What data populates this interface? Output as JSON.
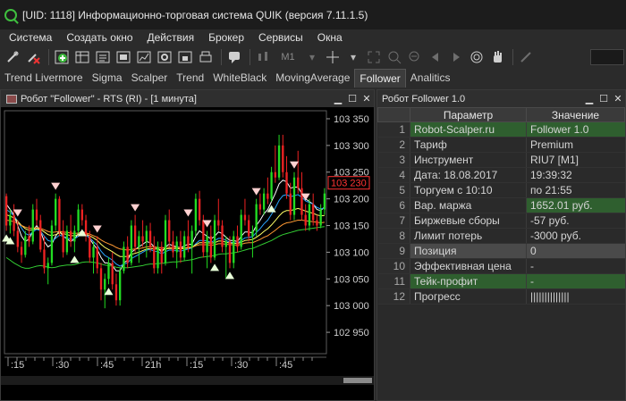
{
  "window": {
    "title": "[UID: 1118] Информационно-торговая система QUIK (версия 7.11.1.5)"
  },
  "menu": {
    "items": [
      "Система",
      "Создать окно",
      "Действия",
      "Брокер",
      "Сервисы",
      "Окна"
    ]
  },
  "toolbar": {
    "timeframe": "M1"
  },
  "tabs": {
    "items": [
      "Trend Livermore",
      "Sigma",
      "Scalper",
      "Trend",
      "WhiteBlack",
      "MovingAverage",
      "Follower",
      "Analitics"
    ],
    "active_index": 6
  },
  "chart_window": {
    "title": "Робот \"Follower\" - RTS (RI) - [1 минута]",
    "current_price": "103 230"
  },
  "colors": {
    "bull": "#22dd22",
    "bear": "#ee2222",
    "current_price": "#ff3333",
    "highlight_row": "#2f5f2f"
  },
  "chart_data": {
    "type": "candlestick",
    "y_ticks": [
      103350,
      103300,
      103250,
      103200,
      103150,
      103100,
      103050,
      103000,
      102950
    ],
    "y_tick_labels": [
      "103 350",
      "103 300",
      "103 250",
      "103 200",
      "103 150",
      "103 100",
      "103 050",
      "103 000",
      "102 950"
    ],
    "ylim": [
      102910,
      103365
    ],
    "x_tick_labels": [
      ":15",
      ":30",
      ":45",
      "21h",
      ":15",
      ":30",
      ":45"
    ],
    "current_price": 103230,
    "candles": [
      [
        103205,
        103210,
        103140,
        103150
      ],
      [
        103150,
        103180,
        103135,
        103170
      ],
      [
        103170,
        103190,
        103130,
        103140
      ],
      [
        103140,
        103160,
        103100,
        103110
      ],
      [
        103110,
        103120,
        103080,
        103095
      ],
      [
        103095,
        103140,
        103090,
        103130
      ],
      [
        103130,
        103150,
        103110,
        103120
      ],
      [
        103120,
        103190,
        103115,
        103180
      ],
      [
        103180,
        103200,
        103150,
        103160
      ],
      [
        103160,
        103170,
        103100,
        103105
      ],
      [
        103105,
        103130,
        103060,
        103070
      ],
      [
        103070,
        103090,
        103040,
        103080
      ],
      [
        103080,
        103160,
        103075,
        103150
      ],
      [
        103150,
        103210,
        103140,
        103200
      ],
      [
        103200,
        103205,
        103130,
        103140
      ],
      [
        103140,
        103160,
        103090,
        103100
      ],
      [
        103100,
        103150,
        103095,
        103140
      ],
      [
        103140,
        103170,
        103110,
        103120
      ],
      [
        103120,
        103150,
        103100,
        103140
      ],
      [
        103140,
        103190,
        103135,
        103180
      ],
      [
        103180,
        103190,
        103150,
        103160
      ],
      [
        103160,
        103170,
        103120,
        103130
      ],
      [
        103130,
        103140,
        103080,
        103090
      ],
      [
        103090,
        103120,
        103060,
        103110
      ],
      [
        103110,
        103130,
        103060,
        103070
      ],
      [
        103070,
        103080,
        103010,
        103030
      ],
      [
        103030,
        103060,
        102995,
        103050
      ],
      [
        103050,
        103090,
        103040,
        103080
      ],
      [
        103080,
        103100,
        103030,
        103040
      ],
      [
        103040,
        103060,
        103000,
        103010
      ],
      [
        103010,
        103070,
        103000,
        103065
      ],
      [
        103065,
        103120,
        103060,
        103110
      ],
      [
        103110,
        103130,
        103070,
        103080
      ],
      [
        103080,
        103160,
        103075,
        103150
      ],
      [
        103150,
        103170,
        103100,
        103110
      ],
      [
        103110,
        103140,
        103080,
        103130
      ],
      [
        103130,
        103160,
        103110,
        103120
      ],
      [
        103120,
        103150,
        103090,
        103140
      ],
      [
        103140,
        103155,
        103100,
        103110
      ],
      [
        103110,
        103130,
        103060,
        103070
      ],
      [
        103070,
        103120,
        103060,
        103110
      ],
      [
        103110,
        103120,
        103060,
        103080
      ],
      [
        103080,
        103170,
        103075,
        103160
      ],
      [
        103160,
        103180,
        103110,
        103120
      ],
      [
        103120,
        103140,
        103090,
        103100
      ],
      [
        103100,
        103130,
        103070,
        103120
      ],
      [
        103120,
        103140,
        103080,
        103090
      ],
      [
        103090,
        103140,
        103085,
        103130
      ],
      [
        103130,
        103160,
        103100,
        103110
      ],
      [
        103110,
        103150,
        103060,
        103140
      ],
      [
        103140,
        103210,
        103130,
        103200
      ],
      [
        103200,
        103215,
        103150,
        103160
      ],
      [
        103160,
        103170,
        103090,
        103100
      ],
      [
        103100,
        103140,
        103070,
        103130
      ],
      [
        103130,
        103150,
        103080,
        103090
      ],
      [
        103090,
        103170,
        103085,
        103160
      ],
      [
        103160,
        103200,
        103140,
        103150
      ],
      [
        103150,
        103160,
        103100,
        103110
      ],
      [
        103110,
        103130,
        103050,
        103120
      ],
      [
        103120,
        103130,
        103070,
        103080
      ],
      [
        103080,
        103140,
        103070,
        103130
      ],
      [
        103130,
        103150,
        103100,
        103110
      ],
      [
        103110,
        103180,
        103105,
        103170
      ],
      [
        103170,
        103200,
        103150,
        103160
      ],
      [
        103160,
        103170,
        103120,
        103130
      ],
      [
        103130,
        103150,
        103090,
        103140
      ],
      [
        103140,
        103200,
        103130,
        103190
      ],
      [
        103190,
        103210,
        103170,
        103180
      ],
      [
        103180,
        103220,
        103170,
        103210
      ],
      [
        103210,
        103240,
        103190,
        103200
      ],
      [
        103200,
        103260,
        103195,
        103250
      ],
      [
        103250,
        103300,
        103230,
        103240
      ],
      [
        103240,
        103320,
        103235,
        103300
      ],
      [
        103300,
        103320,
        103240,
        103250
      ],
      [
        103250,
        103280,
        103200,
        103210
      ],
      [
        103210,
        103230,
        103160,
        103170
      ],
      [
        103170,
        103250,
        103160,
        103240
      ],
      [
        103240,
        103290,
        103210,
        103220
      ],
      [
        103220,
        103250,
        103160,
        103170
      ],
      [
        103170,
        103190,
        103140,
        103150
      ],
      [
        103150,
        103200,
        103140,
        103190
      ],
      [
        103190,
        103210,
        103150,
        103160
      ],
      [
        103160,
        103170,
        103140,
        103150
      ],
      [
        103150,
        103190,
        103145,
        103180
      ],
      [
        103180,
        103220,
        103170,
        103210
      ]
    ],
    "ma_series": [
      {
        "color": "#ffffff",
        "values": [
          103190,
          103180,
          103170,
          103150,
          103130,
          103120,
          103125,
          103140,
          103150,
          103140,
          103120,
          103110,
          103115,
          103130,
          103140,
          103130,
          103125,
          103120,
          103125,
          103135,
          103140,
          103135,
          103125,
          103115,
          103105,
          103090,
          103080,
          103080,
          103075,
          103065,
          103065,
          103080,
          103085,
          103100,
          103105,
          103110,
          103115,
          103120,
          103118,
          103110,
          103108,
          103100,
          103110,
          103115,
          103112,
          103110,
          103108,
          103112,
          103115,
          103115,
          103130,
          103140,
          103135,
          103130,
          103125,
          103130,
          103138,
          103135,
          103128,
          103122,
          103122,
          103120,
          103130,
          103138,
          103138,
          103136,
          103150,
          103160,
          103172,
          103180,
          103195,
          103210,
          103228,
          103235,
          103232,
          103220,
          103222,
          103222,
          103210,
          103200,
          103195,
          103190,
          103180,
          103178,
          103185
        ]
      },
      {
        "color": "#2aa6ff",
        "values": [
          103180,
          103175,
          103168,
          103158,
          103145,
          103135,
          103132,
          103138,
          103143,
          103140,
          103130,
          103122,
          103120,
          103126,
          103132,
          103130,
          103127,
          103124,
          103125,
          103130,
          103133,
          103132,
          103127,
          103120,
          103113,
          103102,
          103094,
          103090,
          103085,
          103078,
          103074,
          103078,
          103080,
          103088,
          103092,
          103096,
          103100,
          103104,
          103105,
          103102,
          103101,
          103097,
          103101,
          103104,
          103104,
          103103,
          103102,
          103104,
          103106,
          103108,
          103116,
          103122,
          103122,
          103121,
          103119,
          103122,
          103126,
          103126,
          103122,
          103119,
          103118,
          103117,
          103122,
          103127,
          103128,
          103129,
          103137,
          103144,
          103153,
          103160,
          103171,
          103183,
          103197,
          103206,
          103208,
          103204,
          103206,
          103208,
          103203,
          103196,
          103193,
          103190,
          103184,
          103181,
          103183
        ]
      },
      {
        "color": "#ffff66",
        "values": [
          103170,
          103168,
          103164,
          103158,
          103150,
          103144,
          103141,
          103142,
          103144,
          103143,
          103138,
          103133,
          103131,
          103133,
          103136,
          103135,
          103133,
          103131,
          103131,
          103133,
          103135,
          103134,
          103131,
          103127,
          103122,
          103115,
          103109,
          103105,
          103101,
          103096,
          103092,
          103092,
          103092,
          103096,
          103098,
          103100,
          103103,
          103106,
          103107,
          103106,
          103106,
          103104,
          103106,
          103107,
          103107,
          103107,
          103106,
          103107,
          103108,
          103109,
          103114,
          103118,
          103118,
          103118,
          103117,
          103118,
          103121,
          103121,
          103119,
          103117,
          103117,
          103116,
          103119,
          103122,
          103123,
          103124,
          103128,
          103133,
          103139,
          103144,
          103151,
          103159,
          103168,
          103175,
          103178,
          103178,
          103180,
          103182,
          103180,
          103177,
          103175,
          103173,
          103170,
          103168,
          103169
        ]
      },
      {
        "color": "#ff9933",
        "values": [
          103160,
          103159,
          103157,
          103154,
          103150,
          103147,
          103145,
          103145,
          103146,
          103145,
          103142,
          103139,
          103137,
          103138,
          103139,
          103138,
          103137,
          103136,
          103135,
          103136,
          103137,
          103136,
          103134,
          103131,
          103128,
          103123,
          103119,
          103116,
          103113,
          103109,
          103106,
          103105,
          103104,
          103105,
          103106,
          103107,
          103108,
          103110,
          103110,
          103110,
          103109,
          103108,
          103109,
          103109,
          103109,
          103109,
          103108,
          103108,
          103109,
          103109,
          103112,
          103114,
          103114,
          103114,
          103113,
          103114,
          103116,
          103116,
          103115,
          103114,
          103114,
          103113,
          103115,
          103117,
          103118,
          103118,
          103121,
          103124,
          103128,
          103131,
          103136,
          103141,
          103147,
          103152,
          103155,
          103156,
          103158,
          103160,
          103160,
          103159,
          103158,
          103157,
          103156,
          103155,
          103156
        ]
      },
      {
        "color": "#33cc33",
        "values": [
          103090,
          103085,
          103080,
          103076,
          103072,
          103070,
          103070,
          103072,
          103074,
          103075,
          103074,
          103072,
          103071,
          103072,
          103074,
          103075,
          103076,
          103076,
          103077,
          103079,
          103081,
          103082,
          103082,
          103081,
          103080,
          103078,
          103076,
          103075,
          103074,
          103072,
          103071,
          103071,
          103071,
          103072,
          103073,
          103074,
          103075,
          103077,
          103078,
          103078,
          103079,
          103079,
          103080,
          103081,
          103082,
          103082,
          103083,
          103084,
          103085,
          103086,
          103088,
          103090,
          103091,
          103092,
          103093,
          103094,
          103096,
          103097,
          103097,
          103098,
          103099,
          103100,
          103102,
          103104,
          103106,
          103107,
          103110,
          103113,
          103116,
          103119,
          103122,
          103126,
          103130,
          103133,
          103135,
          103137,
          103139,
          103141,
          103142,
          103143,
          103144,
          103145,
          103146,
          103147,
          103148
        ]
      }
    ],
    "buy_markers": [
      0,
      1,
      18,
      20,
      27,
      55,
      59,
      70
    ],
    "sell_markers": [
      3,
      13,
      24,
      34,
      48,
      53,
      66,
      76,
      79
    ]
  },
  "follower_panel": {
    "title": "Робот Follower 1.0",
    "columns": [
      "Параметр",
      "Значение"
    ],
    "rows": [
      {
        "num": "1",
        "name": "Robot-Scalper.ru",
        "value": "Follower 1.0",
        "name_hl": "green",
        "value_hl": "green"
      },
      {
        "num": "2",
        "name": "Тариф",
        "value": "Premium",
        "name_hl": "",
        "value_hl": ""
      },
      {
        "num": "3",
        "name": "Инструмент",
        "value": "RIU7  [M1]",
        "name_hl": "",
        "value_hl": ""
      },
      {
        "num": "4",
        "name": "Дата: 18.08.2017",
        "value": "19:39:32",
        "name_hl": "",
        "value_hl": ""
      },
      {
        "num": "5",
        "name": "Торгуем с 10:10",
        "value": "по 21:55",
        "name_hl": "",
        "value_hl": ""
      },
      {
        "num": "6",
        "name": "Вар. маржа",
        "value": "1652.01 руб.",
        "name_hl": "",
        "value_hl": "green"
      },
      {
        "num": "7",
        "name": "Биржевые сборы",
        "value": "-57 руб.",
        "name_hl": "",
        "value_hl": ""
      },
      {
        "num": "8",
        "name": "Лимит потерь",
        "value": "-3000 руб.",
        "name_hl": "",
        "value_hl": ""
      },
      {
        "num": "9",
        "name": "Позиция",
        "value": "0",
        "name_hl": "gray",
        "value_hl": "gray"
      },
      {
        "num": "10",
        "name": "Эффективная цена",
        "value": "-",
        "name_hl": "",
        "value_hl": ""
      },
      {
        "num": "11",
        "name": "Тейк-профит",
        "value": "-",
        "name_hl": "green",
        "value_hl": "green"
      },
      {
        "num": "12",
        "name": "Прогресс",
        "value": "||||||||||||||",
        "name_hl": "",
        "value_hl": ""
      }
    ]
  }
}
